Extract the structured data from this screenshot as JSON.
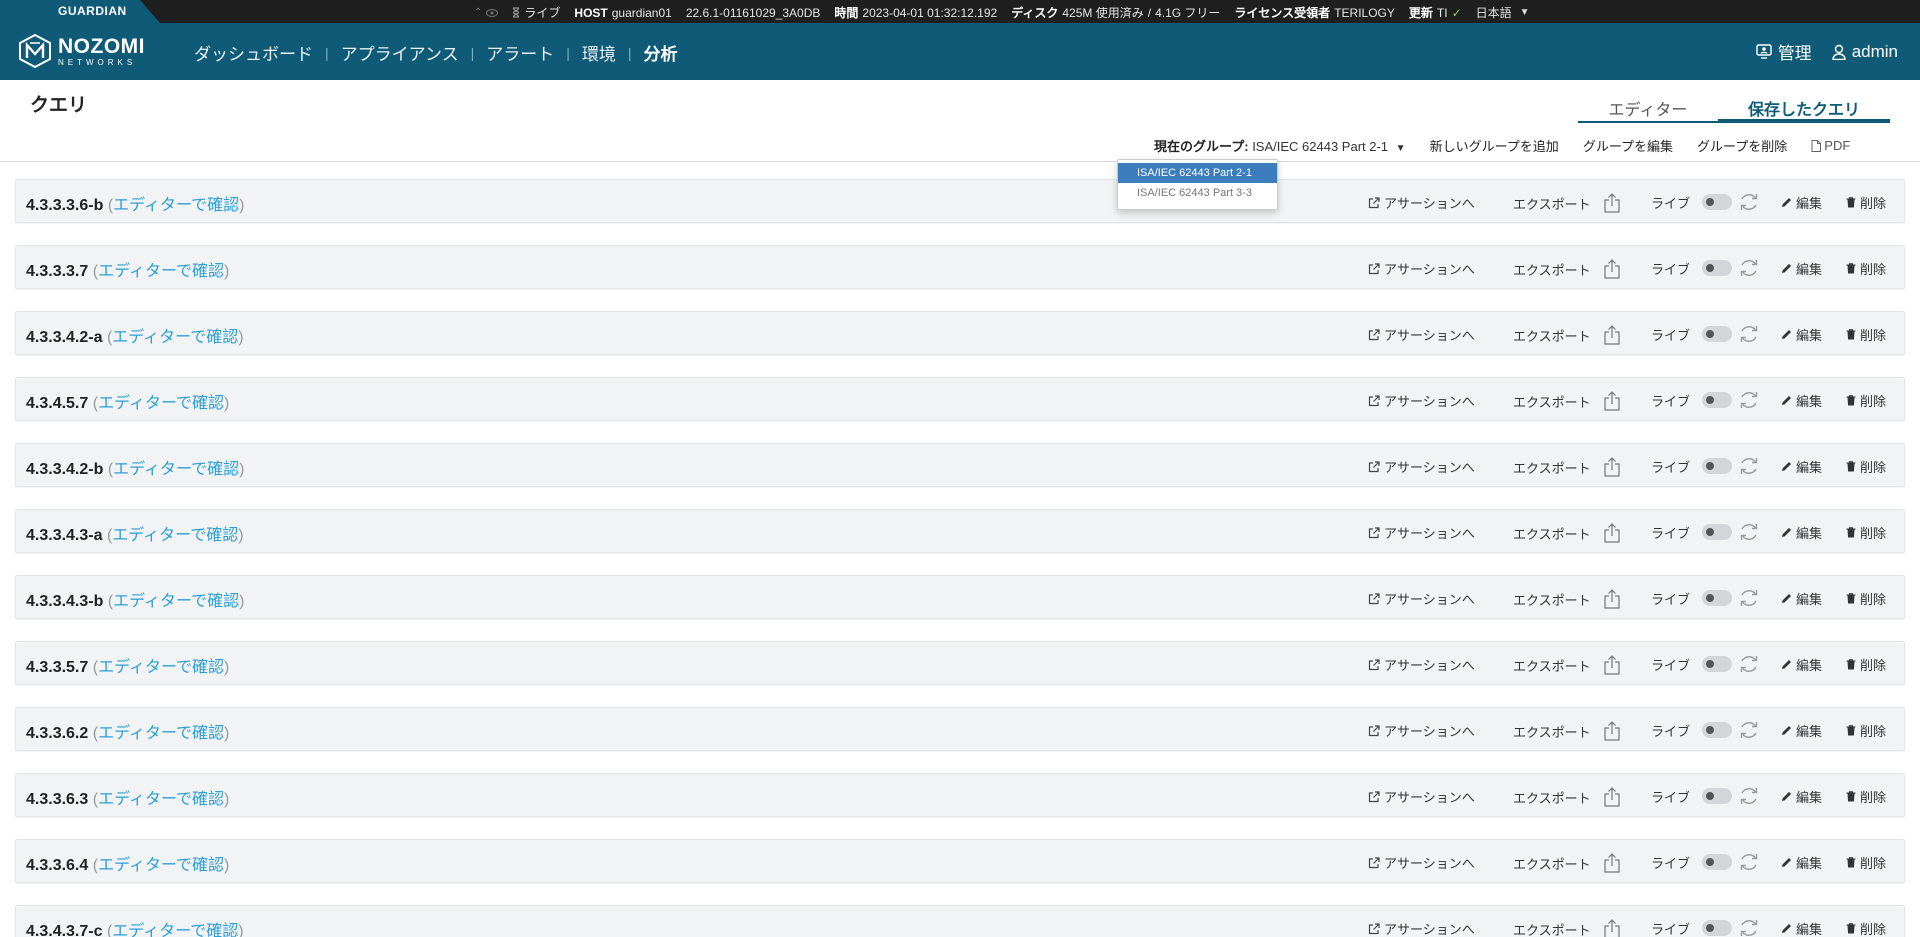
{
  "statusbar": {
    "brand": "GUARDIAN",
    "live_label": "ライブ",
    "host_label": "HOST",
    "host_value": "guardian01",
    "version": "22.6.1-01161029_3A0DB",
    "time_label": "時間",
    "time_value": "2023-04-01 01:32:12.192",
    "disk_label": "ディスク",
    "disk_used": "425M 使用済み",
    "disk_sep": "/",
    "disk_free": "4.1G フリー",
    "license_label": "ライセンス受領者",
    "license_value": "TERILOGY",
    "update_label": "更新",
    "update_value": "TI",
    "language": "日本語"
  },
  "navbar": {
    "logo_line1": "NOZOMI",
    "logo_line2": "NETWORKS",
    "items": [
      {
        "label": "ダッシュボード",
        "active": false
      },
      {
        "label": "アプライアンス",
        "active": false
      },
      {
        "label": "アラート",
        "active": false
      },
      {
        "label": "環境",
        "active": false
      },
      {
        "label": "分析",
        "active": true
      }
    ],
    "separator": "|",
    "admin_label": "管理",
    "user_label": "admin"
  },
  "page": {
    "title": "クエリ",
    "tabs": [
      {
        "label": "エディター",
        "active": false
      },
      {
        "label": "保存したクエリ",
        "active": true
      }
    ]
  },
  "toolbar": {
    "group_label": "現在のグループ:",
    "group_value": "ISA/IEC 62443 Part 2-1",
    "add_group": "新しいグループを追加",
    "edit_group": "グループを編集",
    "delete_group": "グループを削除",
    "pdf": "PDF"
  },
  "dropdown": {
    "options": [
      {
        "label": "ISA/IEC 62443 Part 2-1",
        "selected": true
      },
      {
        "label": "ISA/IEC 62443 Part 3-3",
        "selected": false
      }
    ]
  },
  "row_actions": {
    "assertion": "アサーションへ",
    "export": "エクスポート",
    "live": "ライブ",
    "edit": "編集",
    "delete": "削除",
    "view_in_editor": "エディターで確認"
  },
  "queries": [
    {
      "id": "4.3.3.3.6-b"
    },
    {
      "id": "4.3.3.3.7"
    },
    {
      "id": "4.3.3.4.2-a"
    },
    {
      "id": "4.3.4.5.7"
    },
    {
      "id": "4.3.3.4.2-b"
    },
    {
      "id": "4.3.3.4.3-a"
    },
    {
      "id": "4.3.3.4.3-b"
    },
    {
      "id": "4.3.3.5.7"
    },
    {
      "id": "4.3.3.6.2"
    },
    {
      "id": "4.3.3.6.3"
    },
    {
      "id": "4.3.3.6.4"
    },
    {
      "id": "4.3.4.3.7-c"
    }
  ],
  "colors": {
    "brand": "#0f5b77",
    "link": "#2a9fd6",
    "dropdown_selected": "#3b7dbd"
  }
}
